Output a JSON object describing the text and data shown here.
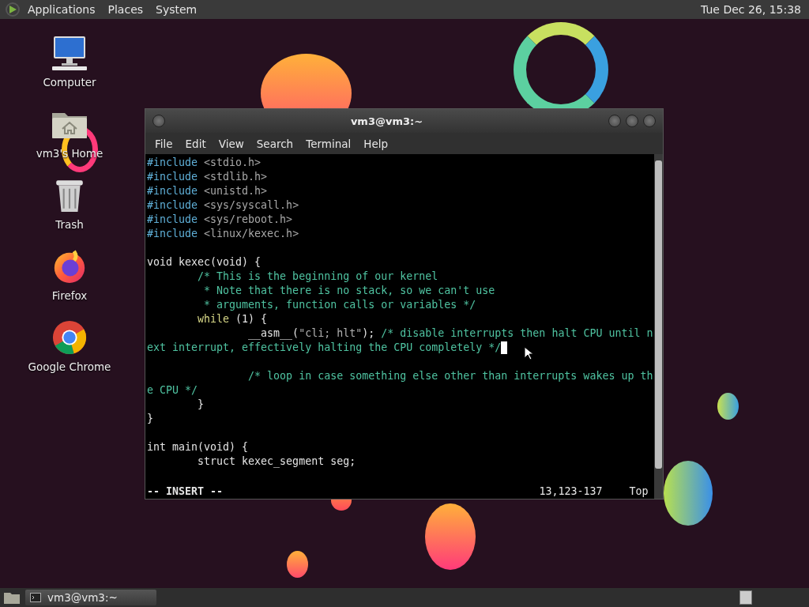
{
  "top_panel": {
    "menus": [
      "Applications",
      "Places",
      "System"
    ],
    "clock": "Tue Dec 26, 15:38"
  },
  "desktop_icons": [
    {
      "kind": "computer",
      "label": "Computer"
    },
    {
      "kind": "home",
      "label": "vm3's Home"
    },
    {
      "kind": "trash",
      "label": "Trash"
    },
    {
      "kind": "firefox",
      "label": "Firefox"
    },
    {
      "kind": "chrome",
      "label": "Google Chrome"
    }
  ],
  "terminal": {
    "title": "vm3@vm3:~",
    "menus": [
      "File",
      "Edit",
      "View",
      "Search",
      "Terminal",
      "Help"
    ],
    "rows": [
      {
        "segments": [
          {
            "kind": "preproc",
            "text": "#include"
          },
          {
            "kind": "header",
            "text": " <stdio.h>"
          }
        ]
      },
      {
        "segments": [
          {
            "kind": "preproc",
            "text": "#include"
          },
          {
            "kind": "header",
            "text": " <stdlib.h>"
          }
        ]
      },
      {
        "segments": [
          {
            "kind": "preproc",
            "text": "#include"
          },
          {
            "kind": "header",
            "text": " <unistd.h>"
          }
        ]
      },
      {
        "segments": [
          {
            "kind": "preproc",
            "text": "#include"
          },
          {
            "kind": "header",
            "text": " <sys/syscall.h>"
          }
        ]
      },
      {
        "segments": [
          {
            "kind": "preproc",
            "text": "#include"
          },
          {
            "kind": "header",
            "text": " <sys/reboot.h>"
          }
        ]
      },
      {
        "segments": [
          {
            "kind": "preproc",
            "text": "#include"
          },
          {
            "kind": "header",
            "text": " <linux/kexec.h>"
          }
        ]
      },
      {
        "segments": []
      },
      {
        "segments": [
          {
            "kind": "plain",
            "text": "void kexec(void) {"
          }
        ]
      },
      {
        "segments": [
          {
            "kind": "comment",
            "text": "        /* This is the beginning of our kernel"
          }
        ]
      },
      {
        "segments": [
          {
            "kind": "comment",
            "text": "         * Note that there is no stack, so we can't use"
          }
        ]
      },
      {
        "segments": [
          {
            "kind": "comment",
            "text": "         * arguments, function calls or variables */"
          }
        ]
      },
      {
        "segments": [
          {
            "kind": "keyword",
            "text": "        while"
          },
          {
            "kind": "plain",
            "text": " (1) {"
          }
        ]
      },
      {
        "segments": [
          {
            "kind": "plain",
            "text": "                __asm__("
          },
          {
            "kind": "string",
            "text": "\"cli; hlt\""
          },
          {
            "kind": "plain",
            "text": "); "
          },
          {
            "kind": "comment",
            "text": "/* disable interrupts then halt CPU until n"
          }
        ]
      },
      {
        "segments": [
          {
            "kind": "comment",
            "text": "ext interrupt, effectively halting the CPU completely */"
          }
        ],
        "cursor": true
      },
      {
        "segments": []
      },
      {
        "segments": [
          {
            "kind": "comment",
            "text": "                /* loop in case something else other than interrupts wakes up th"
          }
        ]
      },
      {
        "segments": [
          {
            "kind": "comment",
            "text": "e CPU */"
          }
        ]
      },
      {
        "segments": [
          {
            "kind": "plain",
            "text": "        }"
          }
        ]
      },
      {
        "segments": [
          {
            "kind": "plain",
            "text": "}"
          }
        ]
      },
      {
        "segments": []
      },
      {
        "segments": [
          {
            "kind": "plain",
            "text": "int main(void) {"
          }
        ]
      },
      {
        "segments": [
          {
            "kind": "plain",
            "text": "        struct kexec_segment seg;"
          }
        ]
      }
    ],
    "mode": "-- INSERT --",
    "position": "13,123-137",
    "scroll": "Top"
  },
  "taskbar": {
    "tasks": [
      {
        "label": "vm3@vm3:~",
        "selected": false
      }
    ]
  }
}
